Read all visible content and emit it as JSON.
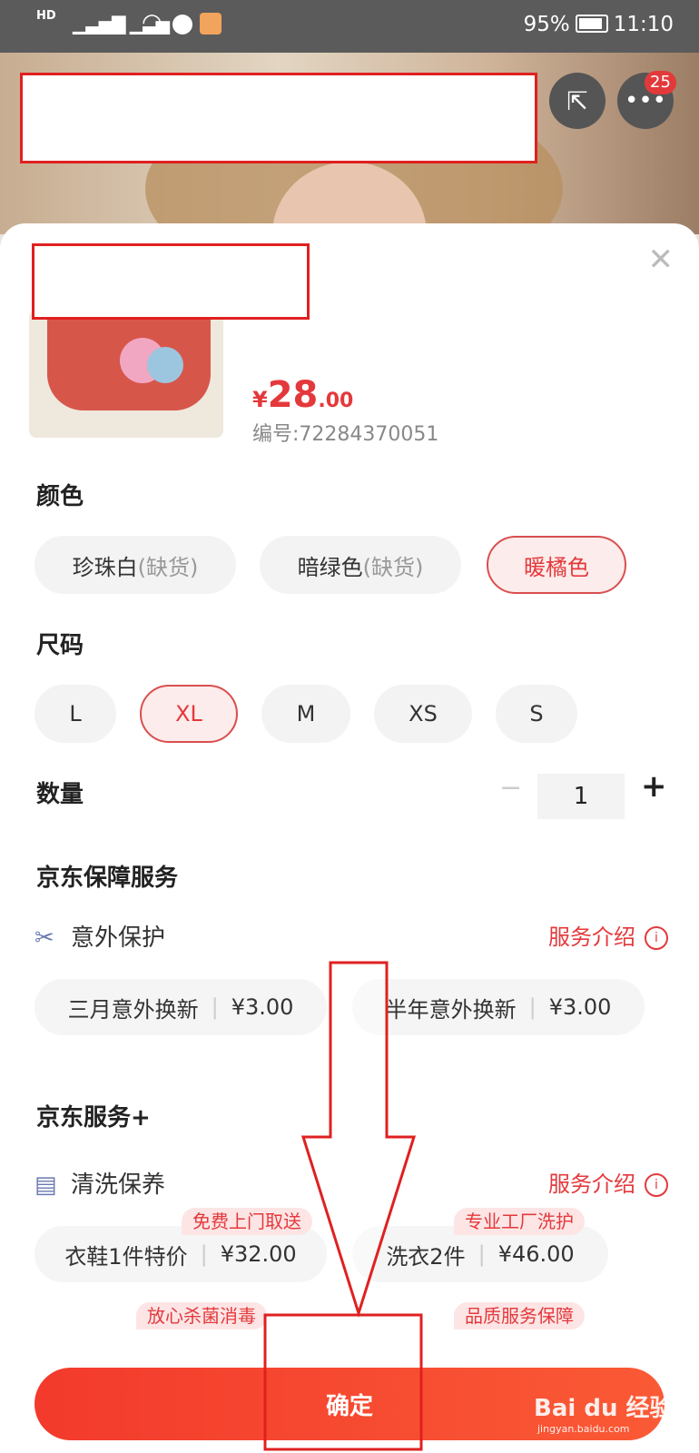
{
  "status_bar": {
    "hd_label": "HD",
    "battery_percent": "95%",
    "time": "11:10"
  },
  "header": {
    "share_icon": "share-icon",
    "more_icon": "more-icon",
    "message_badge": "25"
  },
  "product": {
    "price_currency": "¥",
    "price_int": "28",
    "price_dec": ".00",
    "sku_label": "编号:72284370051"
  },
  "color": {
    "title": "颜色",
    "options": [
      {
        "name": "珍珠白",
        "note": "(缺货)",
        "selected": false
      },
      {
        "name": "暗绿色",
        "note": "(缺货)",
        "selected": false
      },
      {
        "name": "暖橘色",
        "note": "",
        "selected": true
      }
    ]
  },
  "size": {
    "title": "尺码",
    "options": [
      {
        "label": "L",
        "selected": false
      },
      {
        "label": "XL",
        "selected": true
      },
      {
        "label": "M",
        "selected": false
      },
      {
        "label": "XS",
        "selected": false
      },
      {
        "label": "S",
        "selected": false
      }
    ]
  },
  "quantity": {
    "title": "数量",
    "minus": "−",
    "value": "1",
    "plus": "+"
  },
  "jd_guarantee": {
    "title": "京东保障服务",
    "service_name": "意外保护",
    "intro_label": "服务介绍",
    "options": [
      {
        "name": "三月意外换新",
        "price": "¥3.00"
      },
      {
        "name": "半年意外换新",
        "price": "¥3.00"
      }
    ]
  },
  "jd_service_plus": {
    "title": "京东服务+",
    "service_name": "清洗保养",
    "intro_label": "服务介绍",
    "options": [
      {
        "name": "衣鞋1件特价",
        "price": "¥32.00",
        "tag": "免费上门取送"
      },
      {
        "name": "洗衣2件",
        "price": "¥46.00",
        "tag": "专业工厂洗护"
      }
    ],
    "extra_tags": [
      "放心杀菌消毒",
      "品质服务保障"
    ]
  },
  "confirm_label": "确定",
  "watermark": {
    "brand": "Bai du 经验",
    "url": "jingyan.baidu.com"
  },
  "colors": {
    "accent": "#e4393c",
    "annotation": "#e02020"
  }
}
